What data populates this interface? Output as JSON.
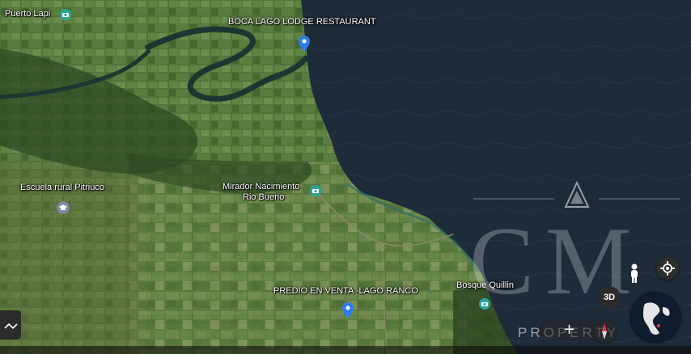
{
  "map": {
    "places": {
      "puerto_lapi": "Puerto Lapi",
      "boca_lago": "BOCA LAGO LODGE RESTAURANT",
      "escuela": "Escuela rural Pitriuco",
      "mirador_line1": "Mirador Nacimiento",
      "mirador_line2": "Rio Bueno",
      "predio": "PREDIO EN VENTA -LAGO RANCO",
      "bosque": "Bosque Quillin"
    },
    "icons": {
      "camera": "camera-icon",
      "pin": "location-pin-icon",
      "school": "school-icon"
    }
  },
  "watermark": {
    "letters": "CM",
    "subtitle": "PROPERTY"
  },
  "controls": {
    "mode_3d": "3D",
    "zoom_in": "+",
    "street_view": "pegman-icon",
    "locate": "my-location-icon",
    "compass": "compass-icon",
    "globe": "globe-icon",
    "expand": "expand-icon"
  },
  "colors": {
    "lake": "#1d2a38",
    "land": "#4a6a36",
    "pin_blue": "#2f7ee8",
    "poi_teal": "#2aa59a"
  }
}
